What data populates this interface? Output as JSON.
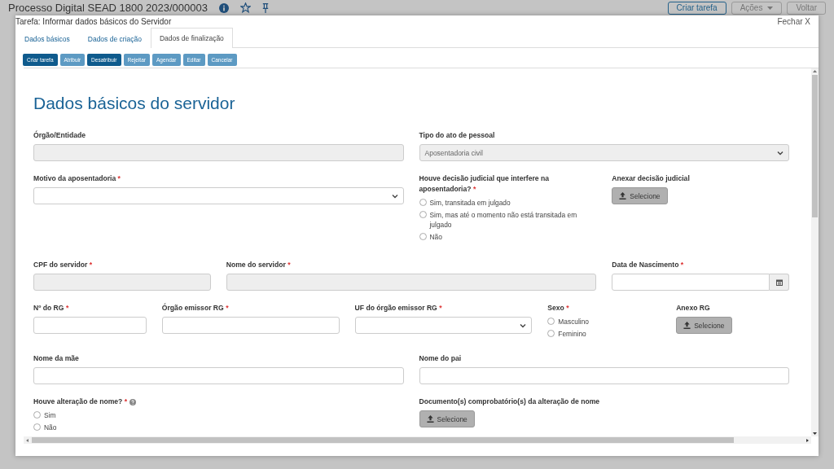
{
  "background": {
    "title": "Processo Digital SEAD 1800 2023/000003",
    "buttons": [
      {
        "label": "Criar tarefa",
        "kind": "outline"
      },
      {
        "label": "Ações",
        "kind": "dropdown"
      },
      {
        "label": "Voltar",
        "kind": "plain"
      }
    ]
  },
  "modal": {
    "title": "Tarefa: Informar dados básicos do Servidor",
    "close": "Fechar X",
    "tabs": [
      {
        "label": "Dados básicos",
        "selected": false
      },
      {
        "label": "Dados de criação",
        "selected": false
      },
      {
        "label": "Dados de finalização",
        "selected": true
      }
    ],
    "actions": [
      {
        "label": "Criar tarefa",
        "disabled": false
      },
      {
        "label": "Atribuir",
        "disabled": true
      },
      {
        "label": "Desatribuir",
        "disabled": false
      },
      {
        "label": "Rejeitar",
        "disabled": true
      },
      {
        "label": "Agendar",
        "disabled": true
      },
      {
        "label": "Editar",
        "disabled": true
      },
      {
        "label": "Cancelar",
        "disabled": true
      }
    ]
  },
  "form": {
    "heading": "Dados básicos do servidor",
    "rows": [
      [
        {
          "kind": "text",
          "label": "Órgão/Entidade",
          "disabled": true
        },
        {
          "kind": "select",
          "label": "Tipo do ato de pessoal",
          "disabled": true,
          "value": "Aposentadoria civil"
        }
      ],
      [
        {
          "kind": "select",
          "label": "Motivo da aposentadoria",
          "required_mark": "*",
          "disabled": false
        },
        {
          "kind": "radio",
          "label": "Houve decisão judicial que interfere na aposentadoria?",
          "required_mark": "*",
          "options": [
            {
              "label": "Sim, transitada em julgado",
              "selected": false
            },
            {
              "label": "Sim, mas até o momento não está transitada em julgado",
              "selected": false
            },
            {
              "label": "Não",
              "selected": false
            }
          ]
        },
        {
          "kind": "file",
          "label": "Anexar decisão judicial",
          "button": "Selecione"
        }
      ],
      [
        {
          "kind": "text",
          "label": "CPF do servidor",
          "required_mark": "*",
          "disabled": true
        },
        {
          "kind": "text",
          "label": "Nome do servidor",
          "required_mark": "*",
          "disabled": true
        },
        {
          "kind": "date",
          "label": "Data de Nascimento",
          "required_mark": "*",
          "disabled": false
        }
      ],
      [
        {
          "kind": "text",
          "label": "Nº do RG",
          "required_mark": "*",
          "disabled": false
        },
        {
          "kind": "text",
          "label": "Órgão emissor RG",
          "required_mark": "*",
          "disabled": false
        },
        {
          "kind": "select",
          "label": "UF do órgão emissor RG",
          "required_mark": "*",
          "disabled": false
        },
        {
          "kind": "radio",
          "label": "Sexo",
          "required_mark": "*",
          "options": [
            {
              "label": "Masculino",
              "selected": false
            },
            {
              "label": "Feminino",
              "selected": false
            }
          ]
        },
        {
          "kind": "file",
          "label": "Anexo RG",
          "button": "Selecione"
        }
      ],
      [
        {
          "kind": "text",
          "label": "Nome da mãe",
          "disabled": false
        },
        {
          "kind": "text",
          "label": "Nome do pai",
          "disabled": false
        }
      ],
      [
        {
          "kind": "radio",
          "label": "Houve alteração de nome?",
          "required_mark": "*",
          "help": true,
          "options": [
            {
              "label": "Sim",
              "selected": false
            },
            {
              "label": "Não",
              "selected": false
            }
          ]
        },
        {
          "kind": "file",
          "label": "Documento(s) comprobatório(s) da alteração de nome",
          "button": "Selecione"
        }
      ]
    ]
  }
}
